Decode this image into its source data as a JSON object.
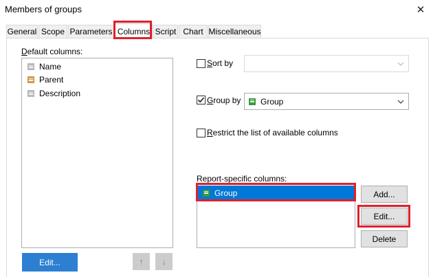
{
  "window": {
    "title": "Members of groups",
    "close_glyph": "✕"
  },
  "tabs": [
    {
      "label": "General"
    },
    {
      "label": "Scope"
    },
    {
      "label": "Parameters"
    },
    {
      "label": "Columns",
      "active": true
    },
    {
      "label": "Script"
    },
    {
      "label": "Chart"
    },
    {
      "label": "Miscellaneous"
    }
  ],
  "default_columns": {
    "label_underlined": "D",
    "label_rest": "efault columns:",
    "items": [
      {
        "label": "Name",
        "icon": "column-icon",
        "color": "#b8b8b8"
      },
      {
        "label": "Parent",
        "icon": "column-icon",
        "color": "#d49a4a"
      },
      {
        "label": "Description",
        "icon": "column-icon",
        "color": "#b8b8b8"
      }
    ],
    "edit_button": "Edit...",
    "move_up_glyph": "↑",
    "move_down_glyph": "↓"
  },
  "sort_by": {
    "checked": false,
    "label_underlined": "S",
    "label_rest": "ort by",
    "value": ""
  },
  "group_by": {
    "checked": true,
    "label_underlined": "G",
    "label_rest": "roup by",
    "value": "Group",
    "icon_color": "#3a9a3a"
  },
  "restrict": {
    "checked": false,
    "label_underlined": "R",
    "label_rest": "estrict the list of available columns"
  },
  "report_columns": {
    "label": "Report-specific columns:",
    "items": [
      {
        "label": "Group",
        "icon_color": "#3a9a3a",
        "selected": true
      }
    ],
    "add_button": "Add...",
    "edit_button": "Edit...",
    "delete_button": "Delete"
  },
  "colors": {
    "accent": "#2d7fd2",
    "selection": "#0078d7",
    "highlight_border": "#e01f2c"
  }
}
